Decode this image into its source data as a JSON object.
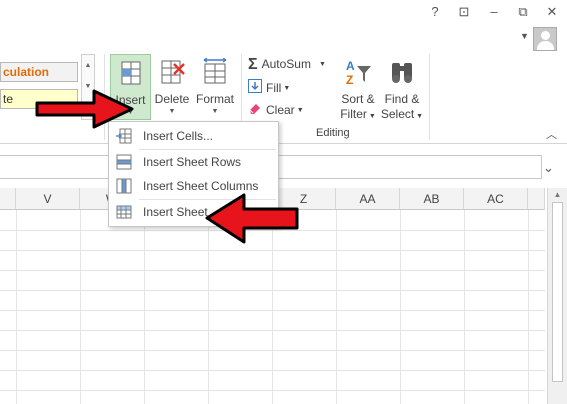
{
  "window": {
    "help": "?",
    "ribbon_display": "⊡",
    "minimize": "–",
    "restore": "⧉",
    "close": "✕"
  },
  "styles": {
    "calculation": "culation",
    "note": "te"
  },
  "cells_group": {
    "insert": "Insert",
    "delete": "Delete",
    "format": "Format"
  },
  "editing_group": {
    "autosum": "AutoSum",
    "fill": "Fill",
    "clear": "Clear",
    "sort_line1": "Sort &",
    "sort_line2": "Filter",
    "find_line1": "Find &",
    "find_line2": "Select",
    "label": "Editing"
  },
  "insert_menu": {
    "items": [
      {
        "label": "Insert Cells...",
        "icon": "insert-cells-icon"
      },
      {
        "label": "Insert Sheet Rows",
        "icon": "insert-rows-icon"
      },
      {
        "label": "Insert Sheet Columns",
        "icon": "insert-columns-icon"
      },
      {
        "label": "Insert Sheet",
        "icon": "insert-sheet-icon"
      }
    ]
  },
  "columns": [
    "V",
    "W",
    "Z",
    "AA",
    "AB",
    "AC"
  ],
  "colors": {
    "insert_highlight": "#cfe9cf",
    "arrow_fill": "#e8141b",
    "calc_text": "#e36c09",
    "note_bg": "#ffffcc"
  }
}
